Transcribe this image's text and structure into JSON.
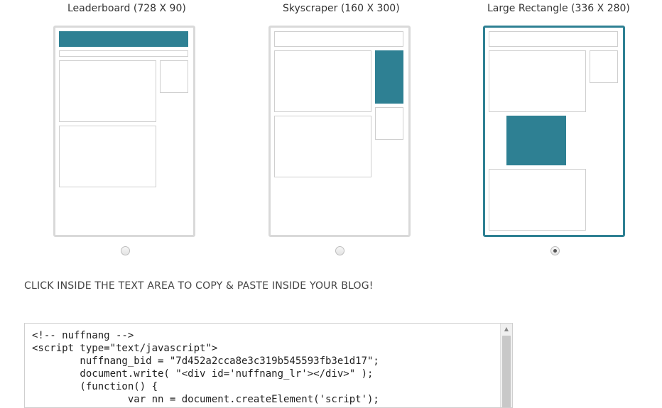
{
  "options": [
    {
      "title": "Leaderboard (728 X 90)",
      "selected": false
    },
    {
      "title": "Skyscraper (160 X 300)",
      "selected": false
    },
    {
      "title": "Large Rectangle (336 X 280)",
      "selected": true
    }
  ],
  "instruction": "CLICK INSIDE THE TEXT AREA TO COPY & PASTE INSIDE YOUR BLOG!",
  "code_lines": [
    "<!-- nuffnang -->",
    "<script type=\"text/javascript\">",
    "        nuffnang_bid = \"7d452a2cca8e3c319b545593fb3e1d17\";",
    "        document.write( \"<div id='nuffnang_lr'></div>\" );",
    "        (function() {",
    "                var nn = document.createElement('script');"
  ],
  "colors": {
    "accent": "#2e8093",
    "border": "#d9d9d9",
    "placeholder_border": "#cfcfcf"
  },
  "icons": {
    "scroll_up": "scroll-up-arrow-icon"
  }
}
